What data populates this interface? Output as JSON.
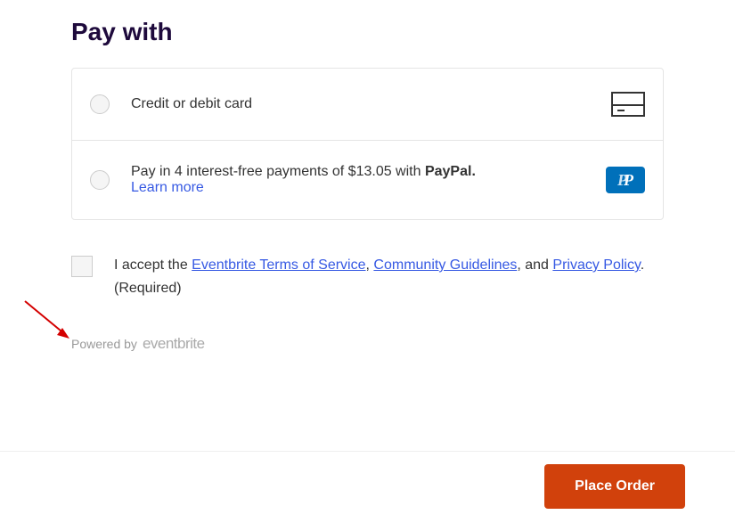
{
  "title": "Pay with",
  "options": {
    "card": {
      "label": "Credit or debit card"
    },
    "paypal": {
      "prefix": "Pay in 4 interest-free payments of $13.05 with ",
      "brand": "PayPal.",
      "learn_more": "Learn more"
    }
  },
  "terms": {
    "prefix": "I accept the ",
    "tos": "Eventbrite Terms of Service",
    "sep1": ", ",
    "cg": "Community Guidelines",
    "sep2": ", and ",
    "pp": "Privacy Policy",
    "suffix": ". (Required)"
  },
  "powered_by": "Powered by",
  "brand": "eventbrite",
  "place_order": "Place Order"
}
